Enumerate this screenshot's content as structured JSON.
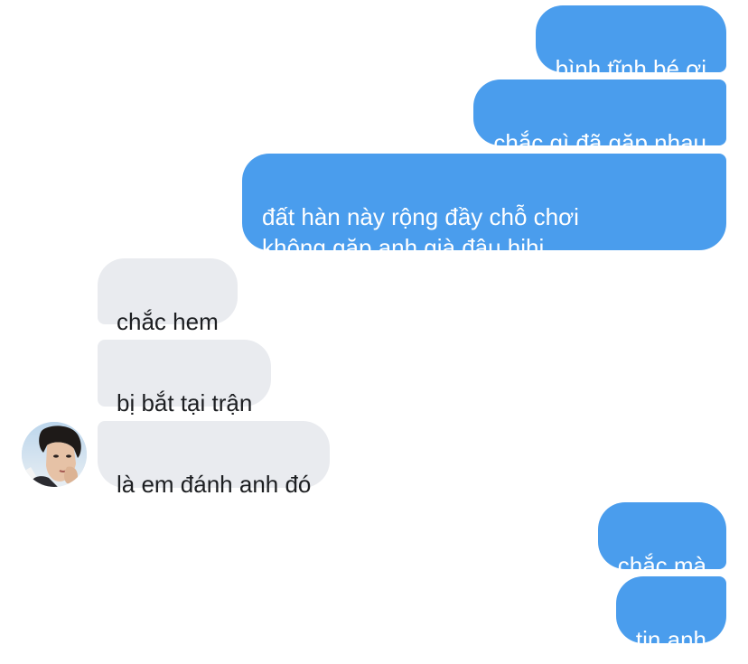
{
  "chat": {
    "messages": [
      {
        "sender": "me",
        "text": "bình tĩnh bé ơi"
      },
      {
        "sender": "me",
        "text": "chắc gì đã gặp nhau"
      },
      {
        "sender": "me",
        "text": "đất hàn này rộng đầy chỗ chơi\nkhông gặp anh già đâu hihi"
      },
      {
        "sender": "other",
        "text": "chắc hem"
      },
      {
        "sender": "other",
        "text": "bị bắt tại trận"
      },
      {
        "sender": "other",
        "text": "là em đánh anh đó"
      },
      {
        "sender": "me",
        "text": "chắc mà"
      },
      {
        "sender": "me",
        "text": "tin anh"
      }
    ]
  },
  "colors": {
    "outgoing_bubble": "#4a9ded",
    "incoming_bubble": "#e9ebef",
    "outgoing_text": "#ffffff",
    "incoming_text": "#1c1e21"
  },
  "avatar": {
    "icon": "user-avatar-photo"
  }
}
